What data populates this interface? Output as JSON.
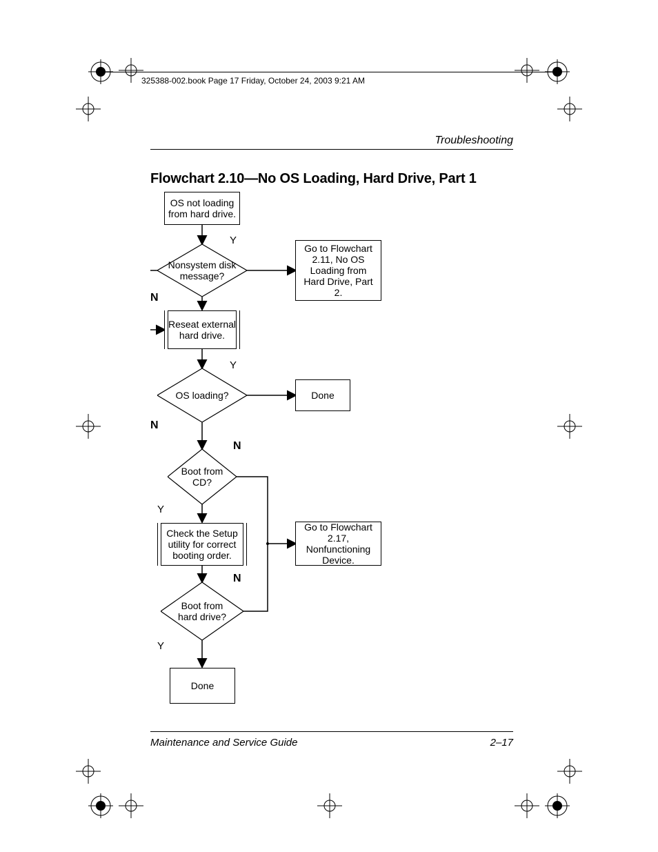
{
  "header_line": "325388-002.book  Page 17  Friday, October 24, 2003  9:21 AM",
  "section": "Troubleshooting",
  "title": "Flowchart 2.10—No OS Loading, Hard Drive, Part 1",
  "footer_left": "Maintenance and Service Guide",
  "footer_right": "2–17",
  "chart_data": {
    "type": "flowchart",
    "nodes": [
      {
        "id": "start",
        "shape": "process",
        "text": "OS not loading from hard drive."
      },
      {
        "id": "d1",
        "shape": "decision",
        "text": "Nonsystem disk message?"
      },
      {
        "id": "ref211",
        "shape": "process",
        "text": "Go to Flowchart 2.11, No OS Loading from Hard Drive, Part 2."
      },
      {
        "id": "reseat",
        "shape": "predefined",
        "text": "Reseat external hard drive."
      },
      {
        "id": "d2",
        "shape": "decision",
        "text": "OS loading?"
      },
      {
        "id": "done1",
        "shape": "process",
        "text": "Done"
      },
      {
        "id": "d3",
        "shape": "decision",
        "text": "Boot from CD?"
      },
      {
        "id": "check",
        "shape": "predefined",
        "text": "Check the Setup utility for correct booting order."
      },
      {
        "id": "ref217",
        "shape": "process",
        "text": "Go to Flowchart 2.17, Nonfunctioning Device."
      },
      {
        "id": "d4",
        "shape": "decision",
        "text": "Boot from hard drive?"
      },
      {
        "id": "done2",
        "shape": "process",
        "text": "Done"
      }
    ],
    "edges": [
      {
        "from": "start",
        "to": "d1",
        "label": ""
      },
      {
        "from": "d1",
        "to": "ref211",
        "label": "Y"
      },
      {
        "from": "d1",
        "to": "reseat",
        "label": "N"
      },
      {
        "from": "reseat",
        "to": "d2",
        "label": ""
      },
      {
        "from": "d2",
        "to": "done1",
        "label": "Y"
      },
      {
        "from": "d2",
        "to": "d3",
        "label": "N"
      },
      {
        "from": "d3",
        "to": "check",
        "label": "Y"
      },
      {
        "from": "d3",
        "to": "ref217",
        "label": "N"
      },
      {
        "from": "check",
        "to": "d4",
        "label": ""
      },
      {
        "from": "d4",
        "to": "done2",
        "label": "Y"
      },
      {
        "from": "d4",
        "to": "ref217",
        "label": "N"
      }
    ],
    "labels": {
      "y": "Y",
      "n": "N"
    }
  }
}
